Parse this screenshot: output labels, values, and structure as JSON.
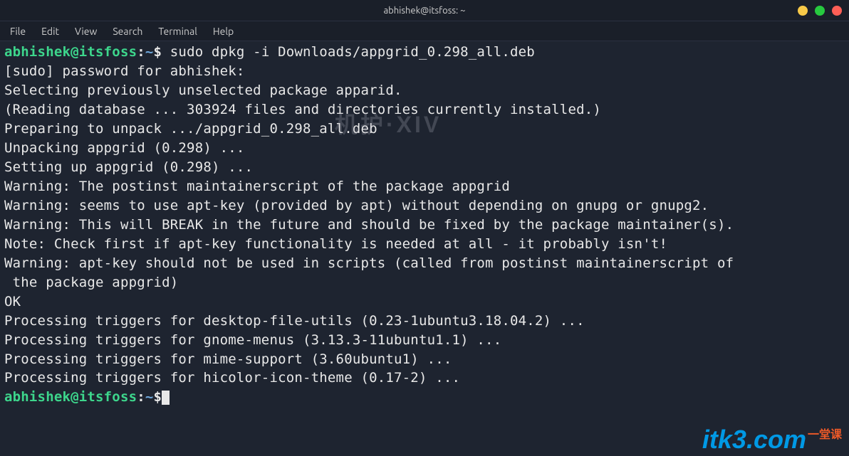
{
  "window": {
    "title": "abhishek@itsfoss: ~"
  },
  "menubar": {
    "file": "File",
    "edit": "Edit",
    "view": "View",
    "search": "Search",
    "terminal": "Terminal",
    "help": "Help"
  },
  "prompt1": {
    "user_host": "abhishek@itsfoss",
    "colon": ":",
    "path": "~",
    "dollar": "$",
    "command": " sudo dpkg -i Downloads/appgrid_0.298_all.deb"
  },
  "output": {
    "l1": "[sudo] password for abhishek:",
    "l2": "Selecting previously unselected package apparid.",
    "l3": "(Reading database ... 303924 files and directories currently installed.)",
    "l4": "Preparing to unpack .../appgrid_0.298_all.deb ",
    "l5": "Unpacking appgrid (0.298) ...",
    "l6": "Setting up appgrid (0.298) ...",
    "l7": "Warning: The postinst maintainerscript of the package appgrid",
    "l8": "Warning: seems to use apt-key (provided by apt) without depending on gnupg or gnupg2.",
    "l9": "Warning: This will BREAK in the future and should be fixed by the package maintainer(s).",
    "l10": "Note: Check first if apt-key functionality is needed at all - it probably isn't!",
    "l11": "Warning: apt-key should not be used in scripts (called from postinst maintainerscript of",
    "l12": " the package appgrid)",
    "l13": "OK",
    "l14": "Processing triggers for desktop-file-utils (0.23-1ubuntu3.18.04.2) ...",
    "l15": "Processing triggers for gnome-menus (3.13.3-11ubuntu1.1) ...",
    "l16": "Processing triggers for mime-support (3.60ubuntu1) ...",
    "l17": "Processing triggers for hicolor-icon-theme (0.17-2) ..."
  },
  "prompt2": {
    "user_host": "abhishek@itsfoss",
    "colon": ":",
    "path": "~",
    "dollar": "$"
  },
  "watermark": "机护·XIV",
  "brand": {
    "domain": "itk3.com",
    "tag": "一堂课"
  }
}
